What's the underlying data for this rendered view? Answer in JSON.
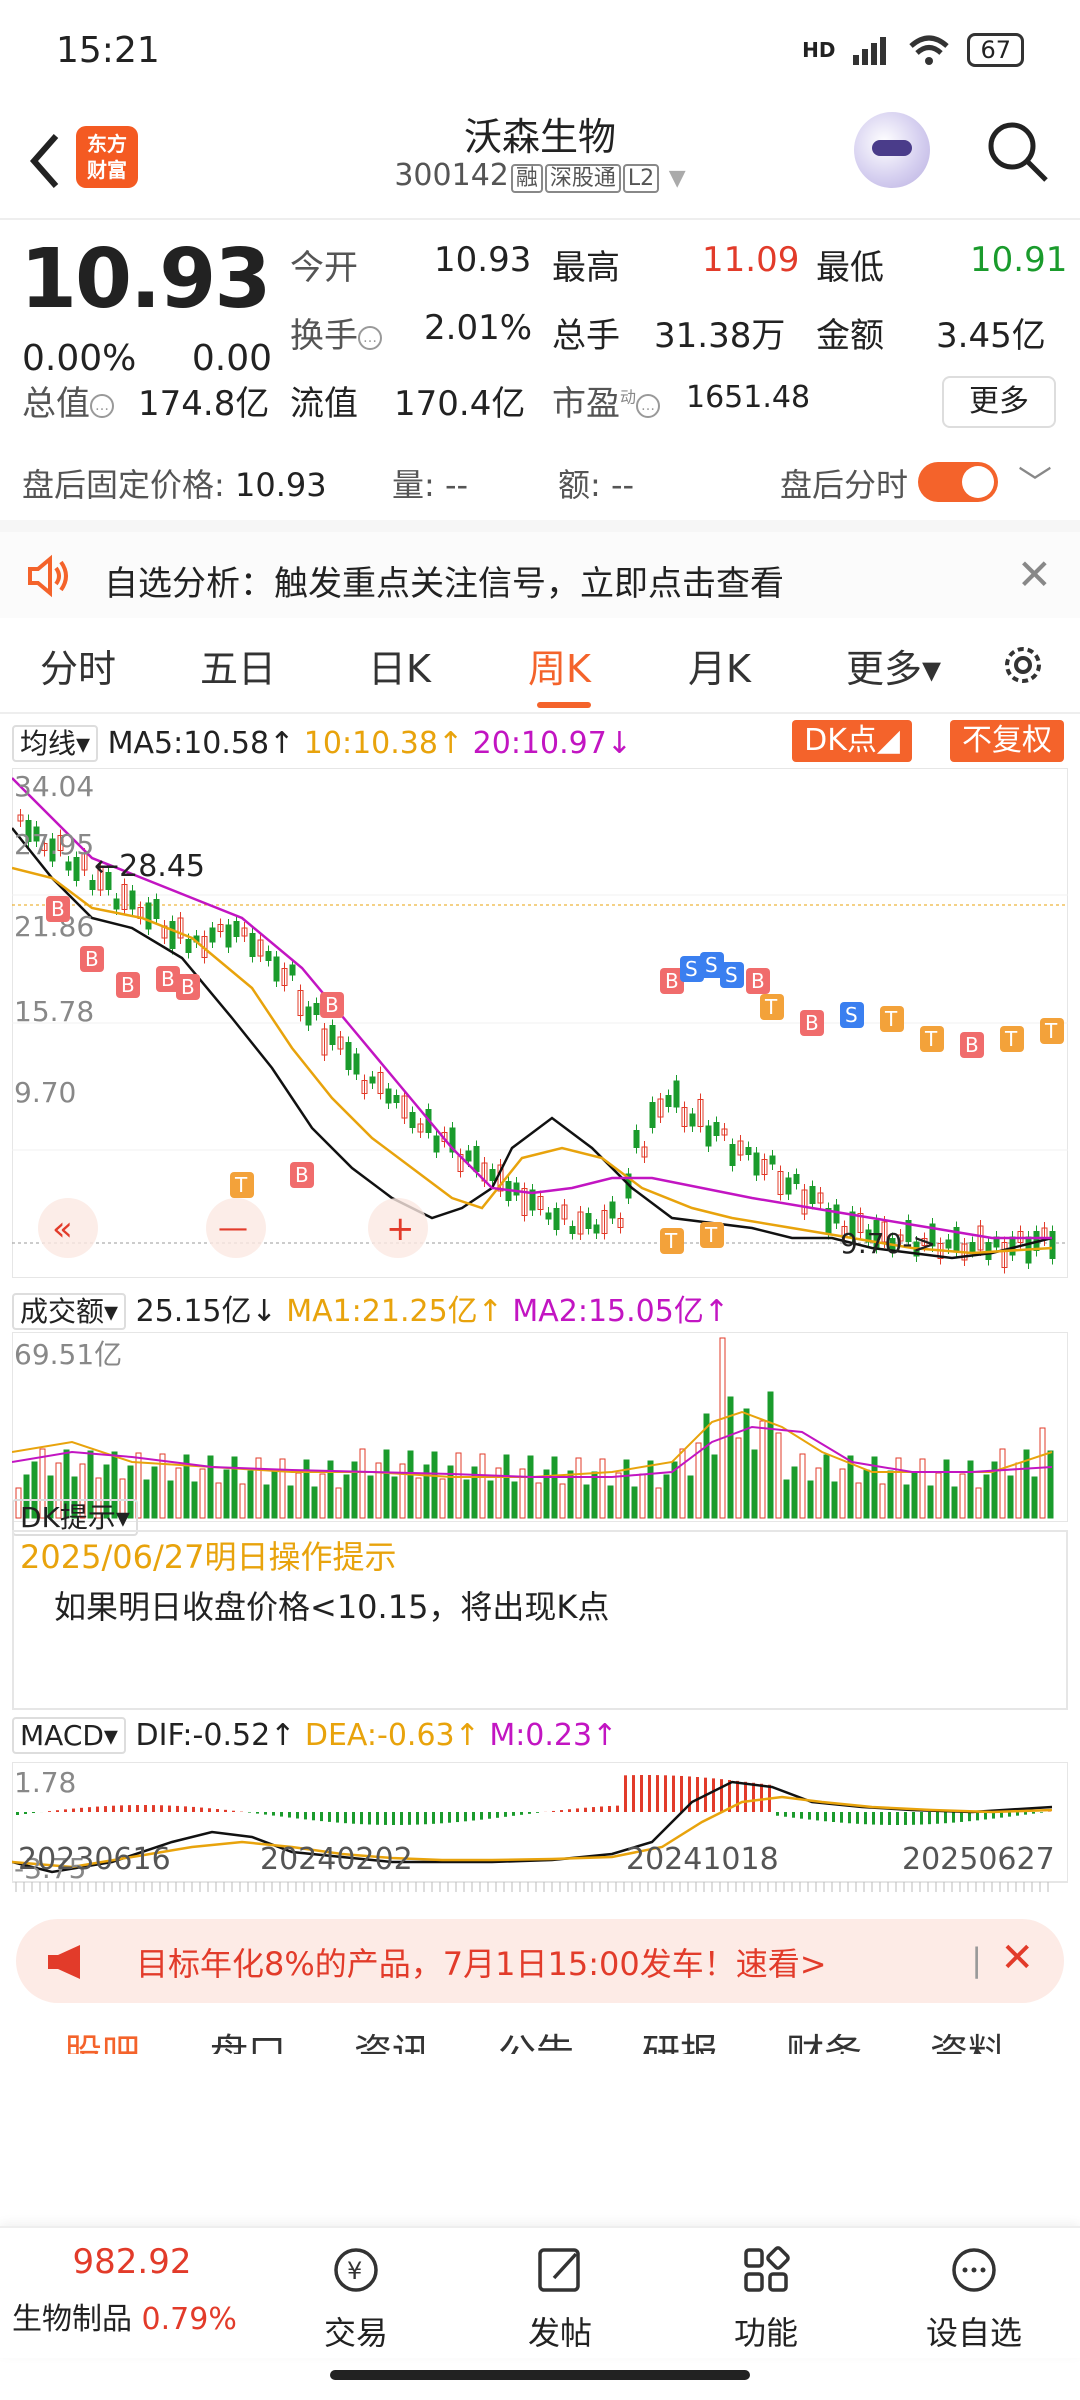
{
  "status": {
    "time": "15:21",
    "network": "HD",
    "battery": "67"
  },
  "header": {
    "logo_line1": "东方",
    "logo_line2": "财富",
    "title": "沃森生物",
    "code": "300142",
    "tag1": "融",
    "tag2": "深股通",
    "tag3": "L2"
  },
  "quote": {
    "price": "10.93",
    "change_pct": "0.00%",
    "change": "0.00",
    "open_label": "今开",
    "open": "10.93",
    "high_label": "最高",
    "high": "11.09",
    "low_label": "最低",
    "low": "10.91",
    "turnover_label": "换手",
    "turnover": "2.01%",
    "volume_label": "总手",
    "volume": "31.38万",
    "amount_label": "金额",
    "amount": "3.45亿",
    "mcap_label": "总值",
    "mcap": "174.8亿",
    "float_label": "流值",
    "float": "170.4亿",
    "pe_label": "市盈",
    "pe_sup": "动",
    "pe": "1651.48",
    "more_button": "更多",
    "after_price_label": "盘后固定价格:",
    "after_price": "10.93",
    "after_vol_label": "量:",
    "after_vol": "--",
    "after_amt_label": "额:",
    "after_amt": "--",
    "after_time_label": "盘后分时"
  },
  "notice": {
    "text": "自选分析：触发重点关注信号，立即点击查看"
  },
  "tabs": [
    "分时",
    "五日",
    "日K",
    "周K",
    "月K",
    "更多▾"
  ],
  "active_tab": "周K",
  "kline": {
    "ma_selector": "均线▾",
    "ma5": "MA5:10.58↑",
    "ma10": "10:10.38↑",
    "ma20": "20:10.97↓",
    "dk_button": "DK点◢",
    "fq_button": "不复权",
    "y_max": "34.04",
    "y_2": "27.95",
    "y_3": "21.86",
    "y_4": "15.78",
    "y_min": "9.70",
    "high_mark": "←28.45",
    "low_mark": "9.70->",
    "prev_btn": "«",
    "minus_btn": "—",
    "plus_btn": "+"
  },
  "volume": {
    "selector": "成交额▾",
    "value": "25.15亿↓",
    "ma1": "MA1:21.25亿↑",
    "ma2": "MA2:15.05亿↑",
    "y_max": "69.51亿"
  },
  "dk": {
    "selector": "DK提示▾",
    "date": "2025/06/27明日操作提示",
    "text": "如果明日收盘价格<10.15，将出现K点"
  },
  "macd": {
    "selector": "MACD▾",
    "dif": "DIF:-0.52↑",
    "dea": "DEA:-0.63↑",
    "m": "M:0.23↑",
    "y_max": "1.78",
    "y_min": "-3.75"
  },
  "dates": [
    "20230616",
    "20240202",
    "20241018",
    "20250627"
  ],
  "ad": {
    "text": "目标年化8%的产品，7月1日15:00发车！速看>",
    "sep": "|"
  },
  "subtabs": [
    "股吧",
    "盘口",
    "资讯",
    "公告",
    "研报",
    "财务",
    "资料"
  ],
  "bottom": {
    "index_value": "982.92",
    "index_name": "生物制品",
    "index_pct": "0.79%",
    "items": [
      "交易",
      "发帖",
      "功能",
      "设自选"
    ]
  },
  "colors": {
    "accent": "#f4632b",
    "up": "#e23b2a",
    "down": "#1a9b2c",
    "ma10": "#e8a30c",
    "ma20": "#c215c2"
  }
}
